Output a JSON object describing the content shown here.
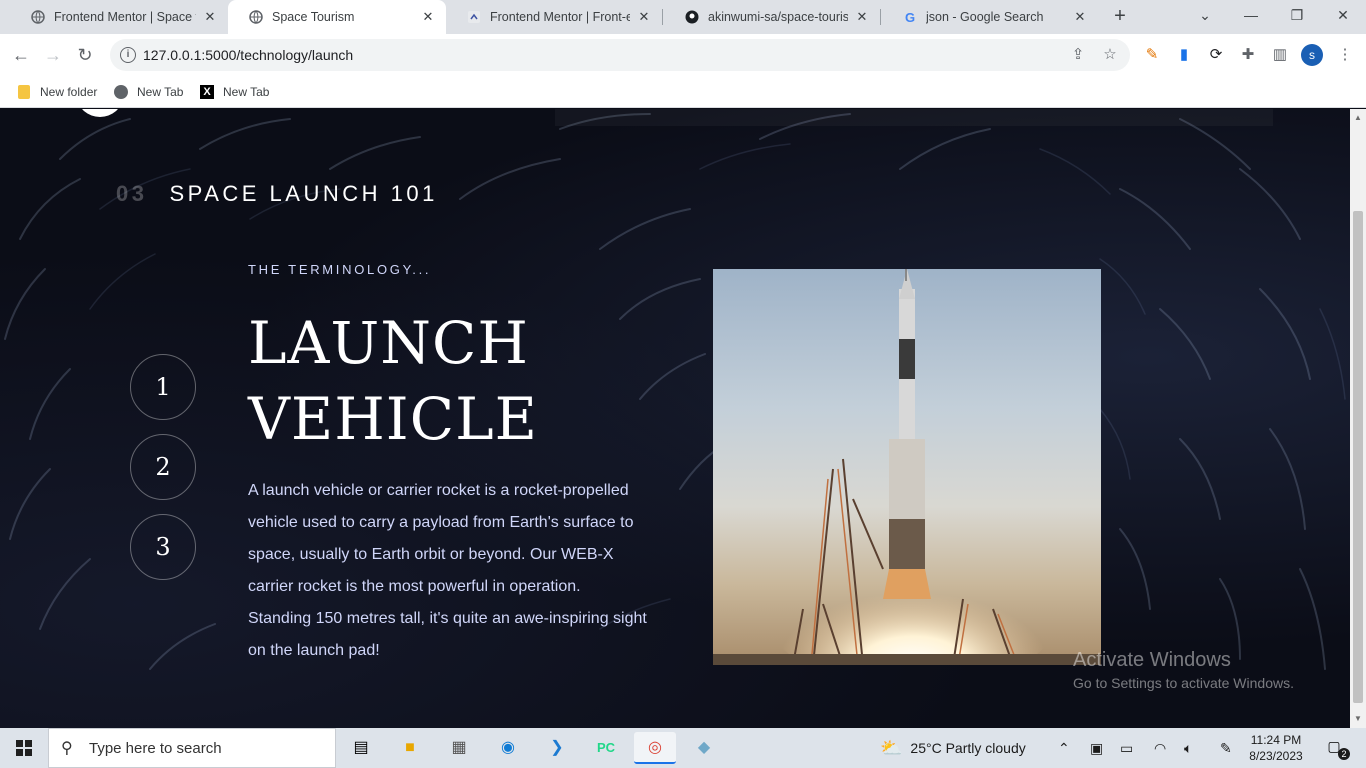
{
  "browser": {
    "tabs": [
      {
        "label": "Frontend Mentor | Space tou",
        "icon": "globe-icon",
        "active": false
      },
      {
        "label": "Space Tourism",
        "icon": "globe-icon",
        "active": true
      },
      {
        "label": "Frontend Mentor | Front-end",
        "icon": "frontendmentor-icon",
        "active": false
      },
      {
        "label": "akinwumi-sa/space-tourism-",
        "icon": "github-icon",
        "active": false
      },
      {
        "label": "json - Google Search",
        "icon": "google-icon",
        "active": false
      }
    ],
    "new_tab_glyph": "+",
    "address": {
      "url": "127.0.0.1:5000/technology/launch"
    },
    "profile_initial": "s",
    "bookmarks": [
      {
        "label": "New folder",
        "icon": "folder-icon"
      },
      {
        "label": "New Tab",
        "icon": "globe-icon"
      },
      {
        "label": "New Tab",
        "icon": "x-icon"
      }
    ]
  },
  "page": {
    "heading_number": "03",
    "heading": "SPACE LAUNCH 101",
    "steps": [
      "1",
      "2",
      "3"
    ],
    "subheading": "THE TERMINOLOGY...",
    "title": "LAUNCH VEHICLE",
    "description": "A launch vehicle or carrier rocket is a rocket-propelled vehicle used to carry a payload from Earth's surface to space, usually to Earth orbit or beyond. Our WEB-X carrier rocket is the most powerful in operation. Standing 150 metres tall, it's quite an awe-inspiring sight on the launch pad!",
    "accent_color": "#d0d6f9",
    "background_color": "#0b0d17"
  },
  "watermark": {
    "line1": "Activate Windows",
    "line2": "Go to Settings to activate Windows."
  },
  "taskbar": {
    "search_placeholder": "Type here to search",
    "weather": "25°C  Partly cloudy",
    "time": "11:24 PM",
    "date": "8/23/2023",
    "notification_count": "2"
  }
}
